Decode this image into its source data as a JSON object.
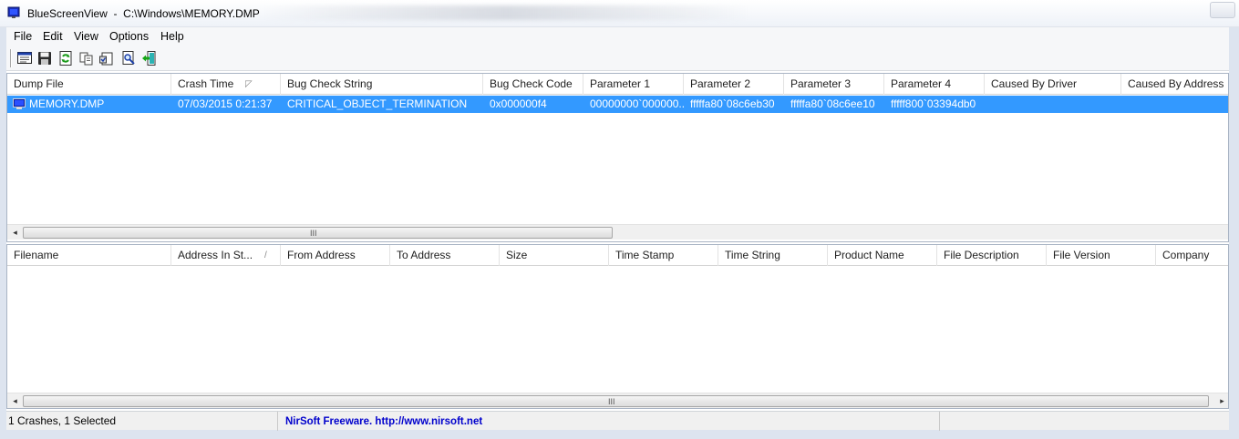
{
  "window": {
    "title": "BlueScreenView  -  C:\\Windows\\MEMORY.DMP"
  },
  "menu": {
    "items": [
      "File",
      "Edit",
      "View",
      "Options",
      "Help"
    ]
  },
  "toolbar": {
    "icons": [
      "html-report-icon",
      "save-icon",
      "refresh-icon",
      "copy-icon",
      "properties-icon",
      "find-icon",
      "exit-icon"
    ]
  },
  "upper_list": {
    "columns": [
      "Dump File",
      "Crash Time",
      "Bug Check String",
      "Bug Check Code",
      "Parameter 1",
      "Parameter 2",
      "Parameter 3",
      "Parameter 4",
      "Caused By Driver",
      "Caused By Address"
    ],
    "sort_glyph": "◸",
    "rows": [
      {
        "dump_file": "MEMORY.DMP",
        "crash_time": "07/03/2015 0:21:37",
        "bug_check_string": "CRITICAL_OBJECT_TERMINATION",
        "bug_check_code": "0x000000f4",
        "parameter_1": "00000000`000000...",
        "parameter_2": "fffffa80`08c6eb30",
        "parameter_3": "fffffa80`08c6ee10",
        "parameter_4": "fffff800`03394db0",
        "caused_by_driver": "",
        "caused_by_address": ""
      }
    ],
    "selected_row_color": "#3399ff"
  },
  "lower_list": {
    "columns": [
      "Filename",
      "Address In St...",
      "From Address",
      "To Address",
      "Size",
      "Time Stamp",
      "Time String",
      "Product Name",
      "File Description",
      "File Version",
      "Company"
    ],
    "sort_glyph": "/",
    "rows": []
  },
  "scrollbar": {
    "left_arrow": "◂",
    "right_arrow": "▸",
    "grip": "III"
  },
  "status": {
    "count_text": "1 Crashes, 1 Selected",
    "link_text": "NirSoft Freeware.  http://www.nirsoft.net"
  }
}
